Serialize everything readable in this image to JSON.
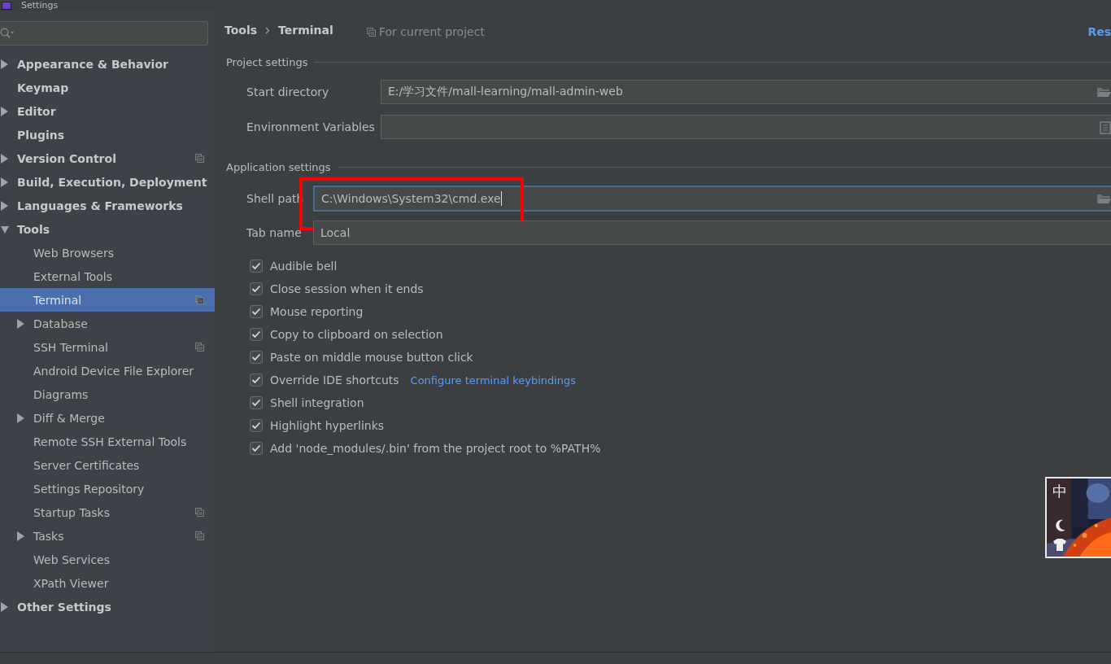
{
  "window": {
    "title": "Settings"
  },
  "sidebar": {
    "items": [
      {
        "label": "Appearance & Behavior",
        "expanded": false,
        "selected": false
      },
      {
        "label": "Keymap",
        "selected": false
      },
      {
        "label": "Editor",
        "expanded": false,
        "selected": false
      },
      {
        "label": "Plugins",
        "selected": false
      },
      {
        "label": "Version Control",
        "expanded": false,
        "selected": false,
        "project_scope": true
      },
      {
        "label": "Build, Execution, Deployment",
        "expanded": false,
        "selected": false
      },
      {
        "label": "Languages & Frameworks",
        "expanded": false,
        "selected": false
      },
      {
        "label": "Tools",
        "expanded": true,
        "selected": false,
        "children": [
          {
            "label": "Web Browsers",
            "selected": false
          },
          {
            "label": "External Tools",
            "selected": false
          },
          {
            "label": "Terminal",
            "selected": true,
            "project_scope": true
          },
          {
            "label": "Database",
            "expanded": false,
            "selected": false
          },
          {
            "label": "SSH Terminal",
            "selected": false,
            "project_scope": true
          },
          {
            "label": "Android Device File Explorer",
            "selected": false
          },
          {
            "label": "Diagrams",
            "selected": false
          },
          {
            "label": "Diff & Merge",
            "expanded": false,
            "selected": false
          },
          {
            "label": "Remote SSH External Tools",
            "selected": false
          },
          {
            "label": "Server Certificates",
            "selected": false
          },
          {
            "label": "Settings Repository",
            "selected": false
          },
          {
            "label": "Startup Tasks",
            "selected": false,
            "project_scope": true
          },
          {
            "label": "Tasks",
            "expanded": false,
            "selected": false,
            "project_scope": true
          },
          {
            "label": "Web Services",
            "selected": false
          },
          {
            "label": "XPath Viewer",
            "selected": false
          }
        ]
      },
      {
        "label": "Other Settings",
        "expanded": false,
        "selected": false
      }
    ]
  },
  "breadcrumb": [
    "Tools",
    "Terminal"
  ],
  "scope_note": "For current project",
  "reset_link": "Res",
  "project_settings": {
    "title": "Project settings",
    "fields": [
      {
        "label": "Start directory",
        "value": "E:/学习文件/mall-learning/mall-admin-web",
        "kind": "path"
      },
      {
        "label": "Environment Variables",
        "kind": "list"
      }
    ]
  },
  "application_settings": {
    "title": "Application settings",
    "fields": [
      {
        "label": "Shell path",
        "value": "C:\\Windows\\System32\\cmd.exe",
        "kind": "path",
        "focused": true,
        "highlighted": true
      },
      {
        "label": "Tab name",
        "value": "Local",
        "kind": "text",
        "focused": false,
        "highlighted": false
      }
    ],
    "options": [
      {
        "label": "Audible bell",
        "checked": true
      },
      {
        "label": "Close session when it ends",
        "checked": true
      },
      {
        "label": "Mouse reporting",
        "checked": true
      },
      {
        "label": "Copy to clipboard on selection",
        "checked": true
      },
      {
        "label": "Paste on middle mouse button click",
        "checked": true
      },
      {
        "label": "Override IDE shortcuts",
        "checked": true,
        "link": "Configure terminal keybindings"
      },
      {
        "label": "Shell integration",
        "checked": true
      },
      {
        "label": "Highlight hyperlinks",
        "checked": true
      },
      {
        "label": "Add 'node_modules/.bin' from the project root to %PATH%",
        "checked": true
      }
    ]
  },
  "ime_widget": {
    "label": "中"
  }
}
